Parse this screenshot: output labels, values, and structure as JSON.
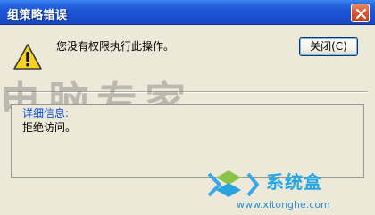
{
  "dialog": {
    "title": "组策略错误",
    "message": "您没有权限执行此操作。",
    "close_button_label": "关闭(C)",
    "details_label": "详细信息:",
    "details_value": "拒绝访问。"
  },
  "watermark": {
    "text": "电脑专家"
  },
  "logo": {
    "name": "系统盒",
    "url": "www.xitonghe.com"
  },
  "icons": {
    "title_close": "close-icon",
    "warning": "warning-icon"
  },
  "colors": {
    "titlebar": "#1b55d6",
    "details_label": "#0046d5",
    "logo_text": "#22a8e6"
  }
}
